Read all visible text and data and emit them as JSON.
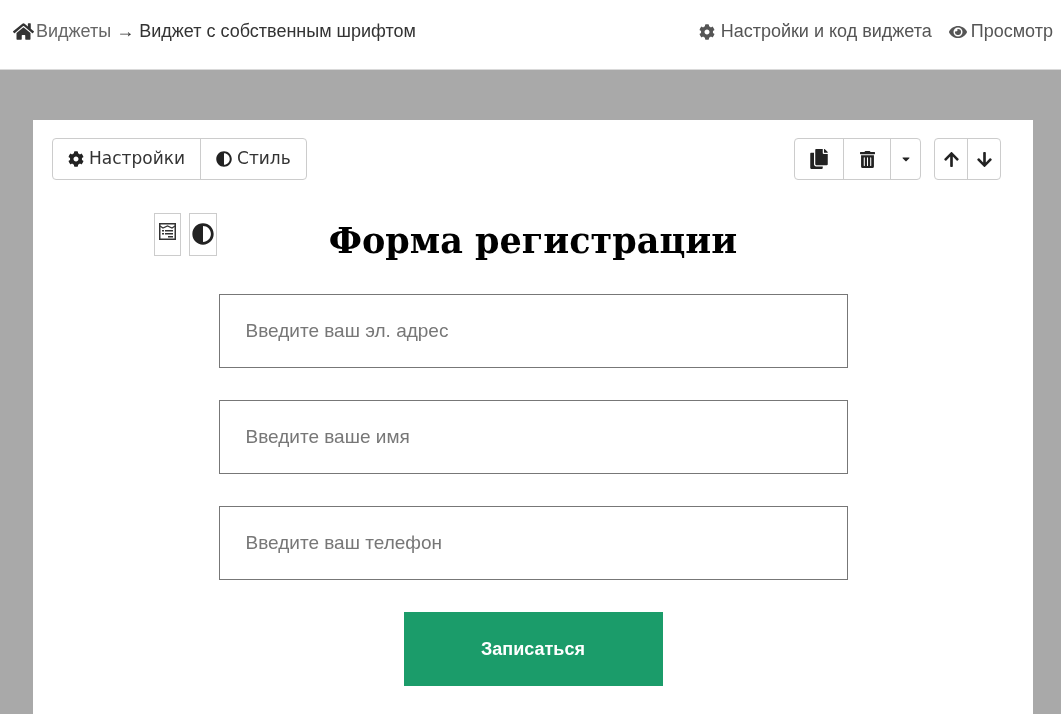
{
  "header": {
    "breadcrumb": {
      "home_link": "Виджеты",
      "separator": "→",
      "current": "Виджет с собственным шрифтом"
    },
    "actions": [
      {
        "kind": "settings",
        "label": "Настройки и код виджета"
      },
      {
        "kind": "preview",
        "label": "Просмотр"
      }
    ]
  },
  "widget_toolbar": {
    "tabs": [
      {
        "kind": "settings",
        "label": "Настройки"
      },
      {
        "kind": "style",
        "label": "Стиль"
      }
    ]
  },
  "form": {
    "title": "Форма регистрации",
    "fields": [
      {
        "placeholder": "Введите ваш эл. адрес"
      },
      {
        "placeholder": "Введите ваше имя"
      },
      {
        "placeholder": "Введите ваш телефон"
      }
    ],
    "submit_button": "Записаться"
  }
}
